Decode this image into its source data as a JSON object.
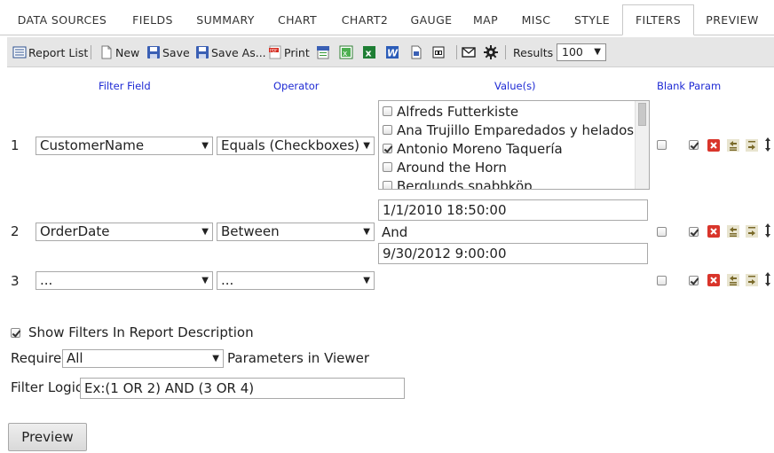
{
  "tabs": [
    {
      "label": "DATA SOURCES"
    },
    {
      "label": "FIELDS"
    },
    {
      "label": "SUMMARY"
    },
    {
      "label": "CHART"
    },
    {
      "label": "CHART2"
    },
    {
      "label": "GAUGE"
    },
    {
      "label": "MAP"
    },
    {
      "label": "MISC"
    },
    {
      "label": "STYLE"
    },
    {
      "label": "FILTERS",
      "active": true
    },
    {
      "label": "PREVIEW"
    }
  ],
  "toolbar": {
    "report_list": "Report List",
    "new": "New",
    "save": "Save",
    "save_as": "Save As...",
    "print": "Print",
    "results_label": "Results",
    "results_value": "100"
  },
  "headers": {
    "filter_field": "Filter Field",
    "operator": "Operator",
    "values": "Value(s)",
    "blank_param": "Blank Param"
  },
  "filters": [
    {
      "num": "1",
      "field": "CustomerName",
      "operator": "Equals (Checkboxes)",
      "options": [
        {
          "label": "Alfreds Futterkiste",
          "checked": false
        },
        {
          "label": "Ana Trujillo Emparedados y helados",
          "checked": false
        },
        {
          "label": "Antonio Moreno Taquería",
          "checked": true
        },
        {
          "label": "Around the Horn",
          "checked": false
        },
        {
          "label": "Berglunds snabbköp",
          "checked": false
        }
      ],
      "blank_param": false,
      "enabled": true
    },
    {
      "num": "2",
      "field": "OrderDate",
      "operator": "Between",
      "value1": "1/1/2010 18:50:00",
      "and_label": "And",
      "value2": "9/30/2012 9:00:00",
      "blank_param": false,
      "enabled": true
    },
    {
      "num": "3",
      "field": "...",
      "operator": "...",
      "blank_param": false,
      "enabled": true
    }
  ],
  "options": {
    "show_filters_label": "Show Filters In Report Description",
    "show_filters_checked": true,
    "require_label": "Require",
    "require_value": "All",
    "require_suffix": "Parameters in Viewer",
    "filter_logic_label": "Filter Logic",
    "filter_logic_placeholder": "Ex:(1 OR 2) AND (3 OR 4)"
  },
  "preview_button": "Preview",
  "colors": {
    "header_blue": "#1e2ad4",
    "toolbar_bg": "#e6e6e6",
    "delete_red": "#d9352b"
  }
}
